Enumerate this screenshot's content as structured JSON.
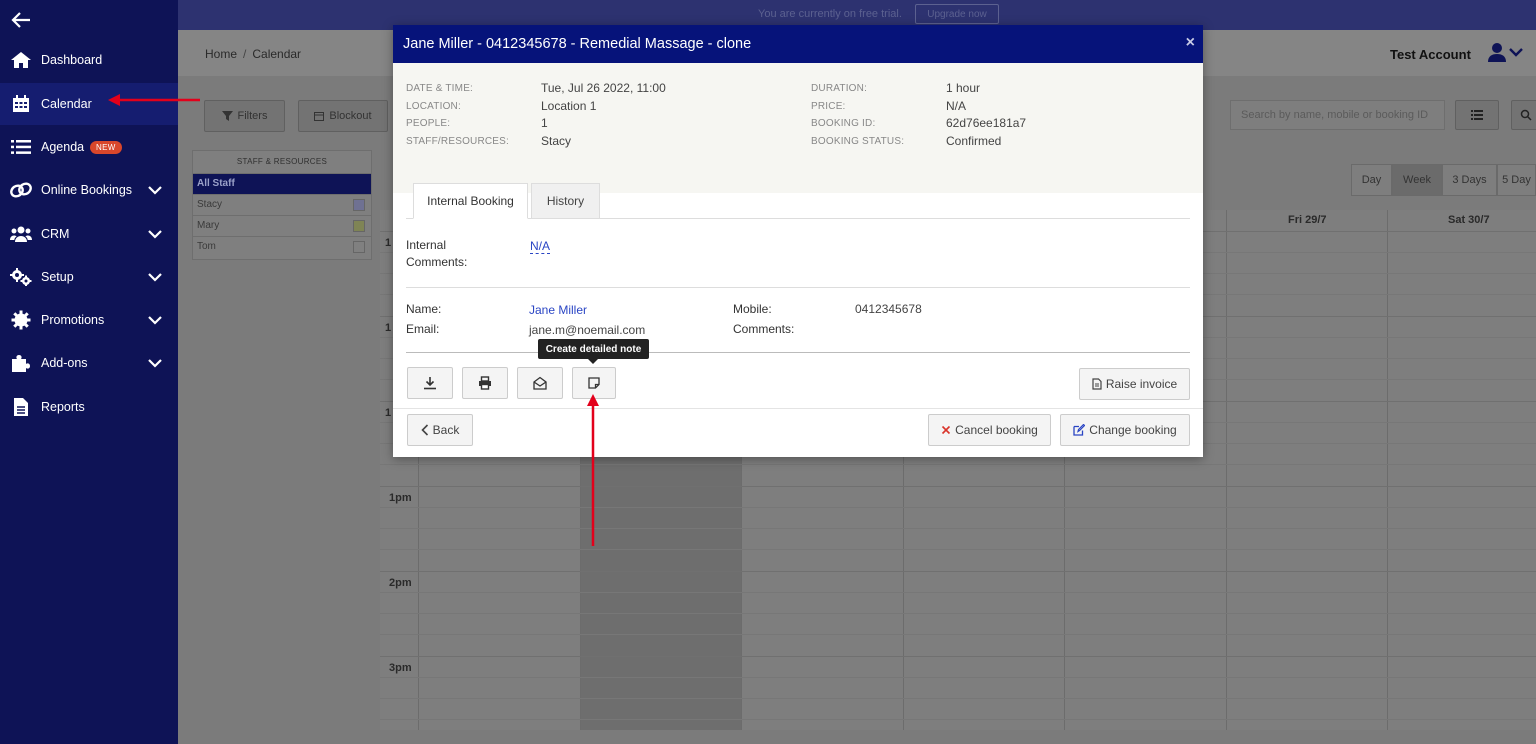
{
  "sidebar": {
    "items": [
      {
        "label": "Dashboard",
        "icon": "home-icon"
      },
      {
        "label": "Calendar",
        "icon": "calendar-icon"
      },
      {
        "label": "Agenda",
        "icon": "list-icon",
        "badge": "NEW"
      },
      {
        "label": "Online Bookings",
        "icon": "link-icon"
      },
      {
        "label": "CRM",
        "icon": "users-icon"
      },
      {
        "label": "Setup",
        "icon": "gears-icon"
      },
      {
        "label": "Promotions",
        "icon": "gear-badge-icon"
      },
      {
        "label": "Add-ons",
        "icon": "puzzle-icon"
      },
      {
        "label": "Reports",
        "icon": "document-icon"
      }
    ]
  },
  "topbar": {
    "trial_text": "You are currently on free trial.",
    "upgrade_label": "Upgrade now"
  },
  "header": {
    "breadcrumb_home": "Home",
    "breadcrumb_separator": "/",
    "breadcrumb_current": "Calendar",
    "account_name": "Test Account"
  },
  "toolbar": {
    "filters_label": "Filters",
    "blockout_label": "Blockout",
    "search_placeholder": "Search by name, mobile or booking ID"
  },
  "staff_panel": {
    "title": "STAFF & RESOURCES",
    "all_label": "All Staff",
    "staff": [
      "Stacy",
      "Mary",
      "Tom"
    ]
  },
  "calendar": {
    "views": [
      "Day",
      "Week",
      "3 Days",
      "5 Day"
    ],
    "selected_view": "Week",
    "day_headers": [
      "Fri 29/7",
      "Sat 30/7"
    ],
    "time_labels": [
      "1pm",
      "2pm",
      "3pm"
    ],
    "partial_time_label": "1"
  },
  "modal": {
    "title": "Jane Miller - 0412345678 - Remedial Massage - clone",
    "close_symbol": "×",
    "summary": {
      "date_time_label": "DATE & TIME:",
      "date_time": "Tue, Jul 26 2022, 11:00",
      "location_label": "LOCATION:",
      "location": "Location 1",
      "people_label": "PEOPLE:",
      "people": "1",
      "staff_label": "STAFF/RESOURCES:",
      "staff": "Stacy",
      "duration_label": "DURATION:",
      "duration": "1 hour",
      "price_label": "PRICE:",
      "price": "N/A",
      "booking_id_label": "BOOKING ID:",
      "booking_id": "62d76ee181a7",
      "status_label": "BOOKING STATUS:",
      "status": "Confirmed"
    },
    "tabs": [
      "Internal Booking",
      "History"
    ],
    "internal_comments_label_1": "Internal",
    "internal_comments_label_2": "Comments:",
    "internal_comments_value": "N/A",
    "client": {
      "name_label": "Name:",
      "name": "Jane Miller",
      "email_label": "Email:",
      "email": "jane.m@noemail.com",
      "mobile_label": "Mobile:",
      "mobile": "0412345678",
      "comments_label": "Comments:"
    },
    "tooltip": "Create detailed note",
    "raise_invoice_label": "Raise invoice",
    "back_label": "Back",
    "cancel_label": "Cancel booking",
    "change_label": "Change booking"
  },
  "colors": {
    "sidebar_bg": "#0e1356",
    "modal_header_bg": "#06137a",
    "annotation_arrow": "#e3001b",
    "link": "#2a45c4",
    "cancel_x": "#d9342b"
  }
}
